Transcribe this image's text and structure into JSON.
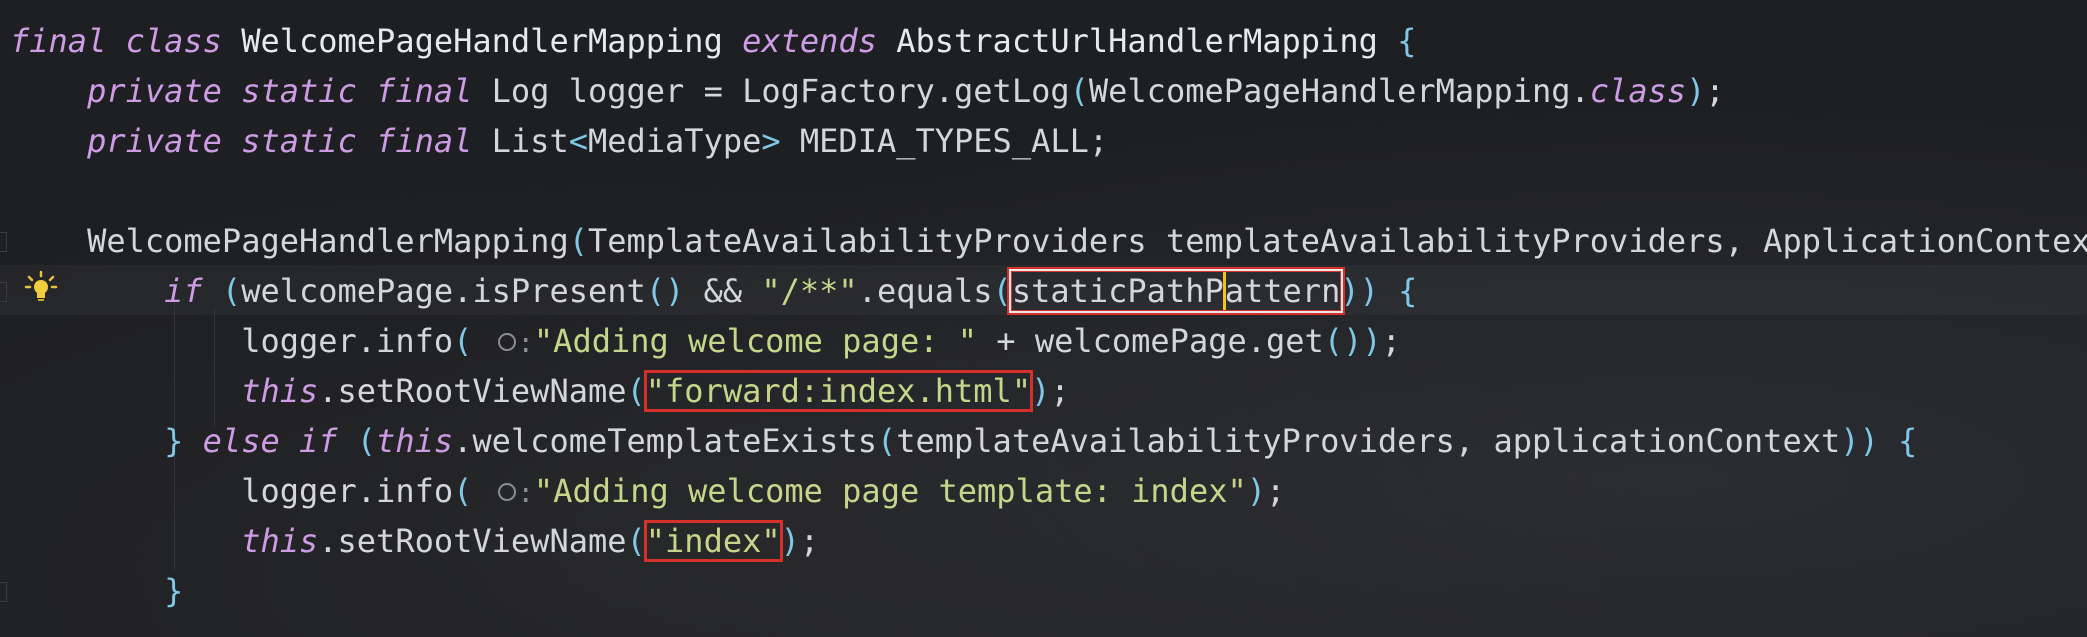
{
  "editor": {
    "lines": [
      {
        "tokens": [
          {
            "t": "final",
            "c": "kw"
          },
          {
            "t": " ",
            "c": "pl"
          },
          {
            "t": "class",
            "c": "kw"
          },
          {
            "t": " WelcomePageHandlerMapping ",
            "c": "cls"
          },
          {
            "t": "extends",
            "c": "kw"
          },
          {
            "t": " AbstractUrlHandlerMapping ",
            "c": "cls"
          },
          {
            "t": "{",
            "c": "paren"
          }
        ]
      },
      {
        "tokens": [
          {
            "t": "    ",
            "c": "pl"
          },
          {
            "t": "private",
            "c": "kw"
          },
          {
            "t": " ",
            "c": "pl"
          },
          {
            "t": "static",
            "c": "kw"
          },
          {
            "t": " ",
            "c": "pl"
          },
          {
            "t": "final",
            "c": "kw"
          },
          {
            "t": " Log logger = LogFactory.getLog",
            "c": "pl"
          },
          {
            "t": "(",
            "c": "paren"
          },
          {
            "t": "WelcomePageHandlerMapping.",
            "c": "pl"
          },
          {
            "t": "class",
            "c": "kw"
          },
          {
            "t": ")",
            "c": "paren"
          },
          {
            "t": ";",
            "c": "pl"
          }
        ]
      },
      {
        "tokens": [
          {
            "t": "    ",
            "c": "pl"
          },
          {
            "t": "private",
            "c": "kw"
          },
          {
            "t": " ",
            "c": "pl"
          },
          {
            "t": "static",
            "c": "kw"
          },
          {
            "t": " ",
            "c": "pl"
          },
          {
            "t": "final",
            "c": "kw"
          },
          {
            "t": " List",
            "c": "pl"
          },
          {
            "t": "<",
            "c": "paren"
          },
          {
            "t": "MediaType",
            "c": "pl"
          },
          {
            "t": ">",
            "c": "paren"
          },
          {
            "t": " MEDIA_TYPES_ALL;",
            "c": "pl"
          }
        ]
      },
      {
        "tokens": []
      },
      {
        "tokens": [
          {
            "t": "    WelcomePageHandlerMapping",
            "c": "pl"
          },
          {
            "t": "(",
            "c": "paren"
          },
          {
            "t": "TemplateAvailabilityProviders templateAvailabilityProviders, ApplicationContext applicationContext",
            "c": "pl"
          }
        ]
      },
      {
        "tokens": [
          {
            "t": "        ",
            "c": "pl"
          },
          {
            "t": "if",
            "c": "kw"
          },
          {
            "t": " ",
            "c": "pl"
          },
          {
            "t": "(",
            "c": "paren"
          },
          {
            "t": "welcomePage.isPresent",
            "c": "pl"
          },
          {
            "t": "()",
            "c": "paren"
          },
          {
            "t": " && ",
            "c": "pl"
          },
          {
            "t": "\"/**\"",
            "c": "str"
          },
          {
            "t": ".equals",
            "c": "pl"
          },
          {
            "t": "(",
            "c": "paren"
          },
          {
            "t": "staticPathP",
            "c": "pl",
            "box": "white-start"
          },
          {
            "t": "attern",
            "c": "pl",
            "box": "white-end"
          },
          {
            "t": "))",
            "c": "paren"
          },
          {
            "t": " ",
            "c": "pl"
          },
          {
            "t": "{",
            "c": "paren"
          }
        ]
      },
      {
        "tokens": [
          {
            "t": "            logger.info",
            "c": "pl"
          },
          {
            "t": "(",
            "c": "paren"
          },
          {
            "t": " ",
            "c": "pl"
          },
          {
            "t": "o:",
            "c": "hint"
          },
          {
            "t": "\"Adding welcome page: \"",
            "c": "str"
          },
          {
            "t": " + welcomePage.get",
            "c": "pl"
          },
          {
            "t": "())",
            "c": "paren"
          },
          {
            "t": ";",
            "c": "pl"
          }
        ]
      },
      {
        "tokens": [
          {
            "t": "            ",
            "c": "pl"
          },
          {
            "t": "this",
            "c": "kw"
          },
          {
            "t": ".setRootViewName",
            "c": "pl"
          },
          {
            "t": "(",
            "c": "paren"
          },
          {
            "t": "\"forward:index.html\"",
            "c": "str",
            "box": "red"
          },
          {
            "t": ")",
            "c": "paren"
          },
          {
            "t": ";",
            "c": "pl"
          }
        ]
      },
      {
        "tokens": [
          {
            "t": "        ",
            "c": "pl"
          },
          {
            "t": "}",
            "c": "paren"
          },
          {
            "t": " ",
            "c": "pl"
          },
          {
            "t": "else",
            "c": "kw"
          },
          {
            "t": " ",
            "c": "pl"
          },
          {
            "t": "if",
            "c": "kw"
          },
          {
            "t": " ",
            "c": "pl"
          },
          {
            "t": "(",
            "c": "paren"
          },
          {
            "t": "this",
            "c": "kw"
          },
          {
            "t": ".welcomeTemplateExists",
            "c": "pl"
          },
          {
            "t": "(",
            "c": "paren"
          },
          {
            "t": "templateAvailabilityProviders, applicationContext",
            "c": "pl"
          },
          {
            "t": "))",
            "c": "paren"
          },
          {
            "t": " ",
            "c": "pl"
          },
          {
            "t": "{",
            "c": "paren"
          }
        ]
      },
      {
        "tokens": [
          {
            "t": "            logger.info",
            "c": "pl"
          },
          {
            "t": "(",
            "c": "paren"
          },
          {
            "t": " ",
            "c": "pl"
          },
          {
            "t": "o:",
            "c": "hint"
          },
          {
            "t": "\"Adding welcome page template: index\"",
            "c": "str"
          },
          {
            "t": ")",
            "c": "paren"
          },
          {
            "t": ";",
            "c": "pl"
          }
        ]
      },
      {
        "tokens": [
          {
            "t": "            ",
            "c": "pl"
          },
          {
            "t": "this",
            "c": "kw"
          },
          {
            "t": ".setRootViewName",
            "c": "pl"
          },
          {
            "t": "(",
            "c": "paren"
          },
          {
            "t": "\"index\"",
            "c": "str",
            "box": "red"
          },
          {
            "t": ")",
            "c": "paren"
          },
          {
            "t": ";",
            "c": "pl"
          }
        ]
      },
      {
        "tokens": [
          {
            "t": "        ",
            "c": "pl"
          },
          {
            "t": "}",
            "c": "paren"
          }
        ]
      }
    ]
  },
  "colors": {
    "background": "#1e1f23",
    "keyword": "#cd9ce4",
    "string": "#c7d58a",
    "bracket": "#7fc8e8",
    "plain": "#d3d6da",
    "highlight_box": "#d6302b",
    "caret": "#f0c419"
  },
  "icons": {
    "intention_bulb": "lightbulb-icon",
    "parameter_hint": "parameter-hint-icon"
  }
}
